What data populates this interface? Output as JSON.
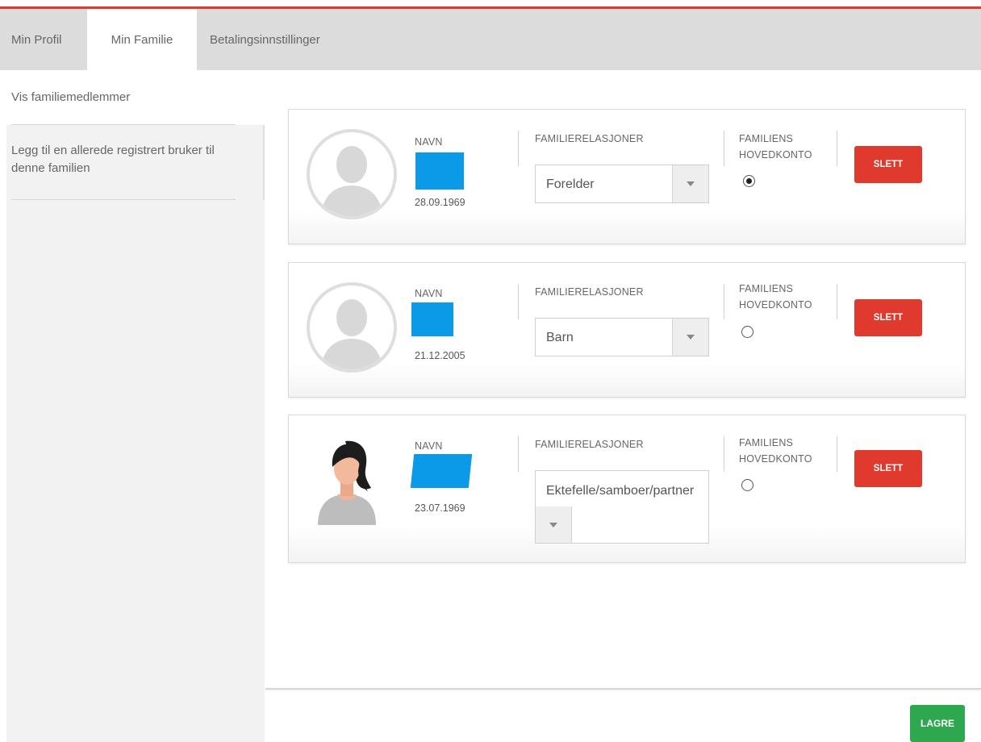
{
  "tabs": [
    {
      "label": "Min Profil"
    },
    {
      "label": "Min Familie"
    },
    {
      "label": "Betalingsinnstillinger"
    }
  ],
  "sidebar": {
    "items": [
      {
        "label": "Vis familiemedlemmer"
      },
      {
        "label": "Legg til en allerede registrert bruker til denne familien"
      }
    ]
  },
  "columns": {
    "name": "NAVN",
    "relation": "FAMILIERELASJONER",
    "main_account": "FAMILIENS HOVEDKONTO"
  },
  "members": [
    {
      "birthdate": "28.09.1969",
      "relation": "Forelder",
      "main_account": true,
      "avatar": "generic-avatar",
      "delete_label": "SLETT"
    },
    {
      "birthdate": "21.12.2005",
      "relation": "Barn",
      "main_account": false,
      "avatar": "generic-avatar",
      "delete_label": "SLETT"
    },
    {
      "birthdate": "23.07.1969",
      "relation": "Ektefelle/samboer/partner",
      "main_account": false,
      "avatar": "woman-avatar",
      "delete_label": "SLETT"
    }
  ],
  "save_label": "LAGRE",
  "colors": {
    "accent_red": "#e03a2f",
    "save_green": "#2ea84f",
    "redaction_blue": "#0a9ae8"
  }
}
